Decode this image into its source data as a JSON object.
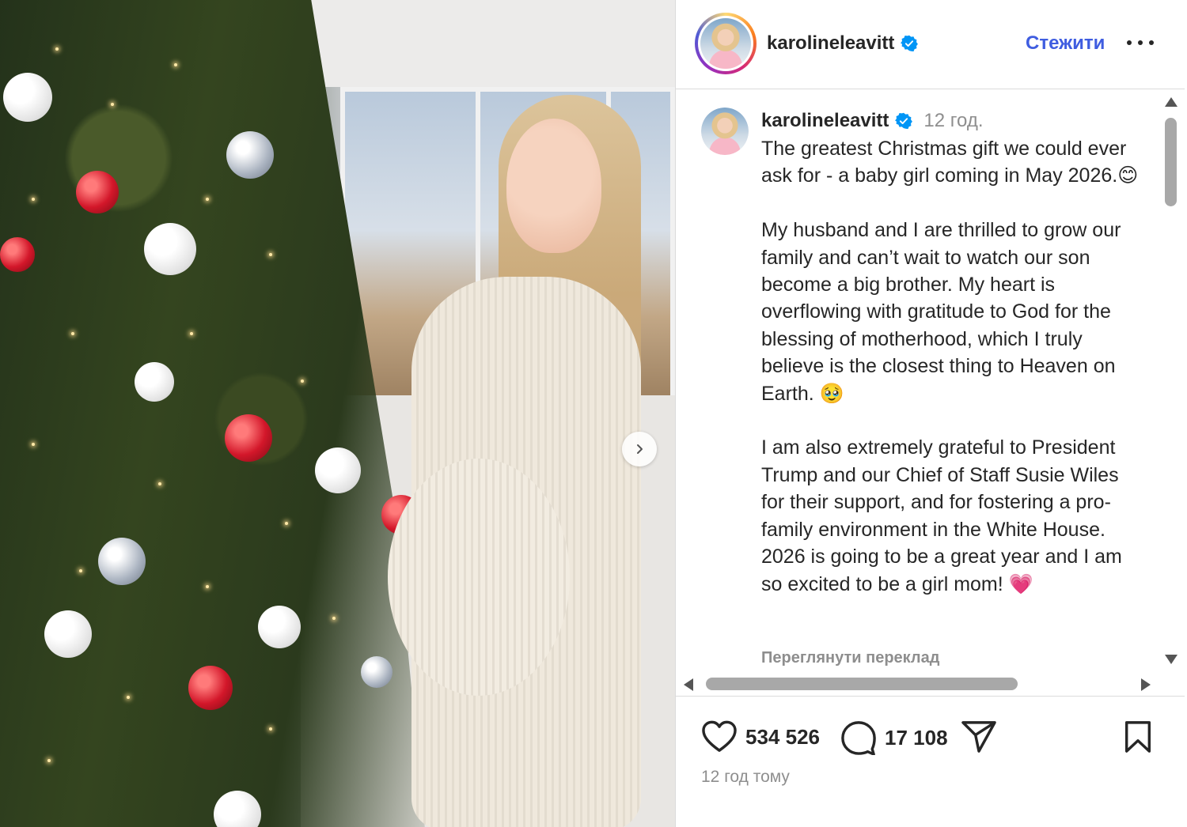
{
  "post_image": {
    "alt_icon": "carousel-next-icon"
  },
  "header": {
    "username": "karolineleavitt",
    "verified_icon": "verified-badge-icon",
    "follow_label": "Стежити",
    "more_icon": "more-options-icon",
    "accent_color": "#3f5de0"
  },
  "caption": {
    "username": "karolineleavitt",
    "time": "12 год.",
    "text": "The greatest Christmas gift we could ever ask for - a baby girl coming in May 2026.😊\n\nMy husband and I are thrilled to grow our family and can’t wait to watch our son become a big brother. My heart is overflowing with gratitude to God for the blessing of motherhood, which I truly believe is the closest thing to Heaven on Earth. 🥹\n\nI am also extremely grateful to President Trump and our Chief of Staff Susie Wiles for their support, and for fostering a pro-family environment in the White House. 2026 is going to be a great year and I am so excited to be a girl mom! 💗",
    "translate_label": "Переглянути переклад"
  },
  "actions": {
    "likes": "534 526",
    "comments": "17 108",
    "like_icon": "heart-icon",
    "comment_icon": "comment-icon",
    "share_icon": "send-icon",
    "save_icon": "bookmark-icon"
  },
  "posted": "12 год тому"
}
